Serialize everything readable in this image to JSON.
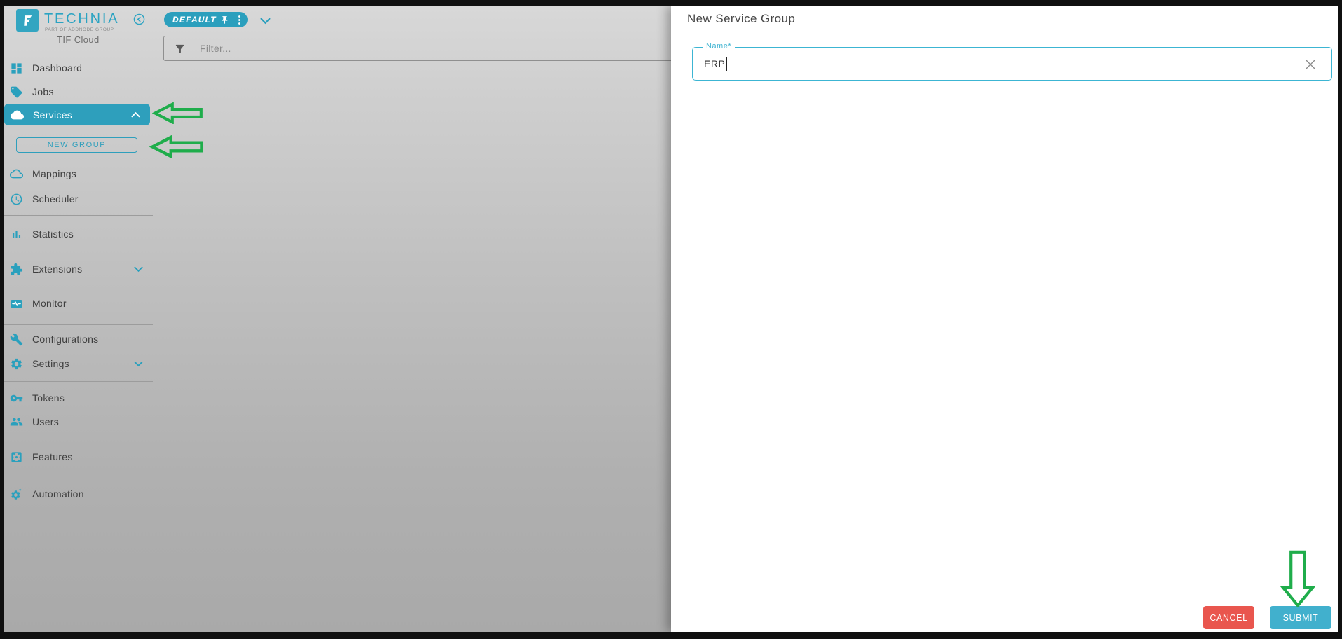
{
  "header": {
    "brand": "TECHNIA",
    "brand_tagline": "PART OF ADDNODE GROUP",
    "environment_badge": "DEFAULT",
    "app_name": "TIF Cloud",
    "filter_placeholder": "Filter..."
  },
  "sidebar": {
    "items": [
      {
        "label": "Dashboard",
        "icon": "dashboard-icon"
      },
      {
        "label": "Jobs",
        "icon": "jobs-tag-icon"
      },
      {
        "label": "Services",
        "icon": "services-cloud-icon",
        "selected": true,
        "expanded": true
      },
      {
        "label": "Mappings",
        "icon": "mappings-cloud-icon"
      },
      {
        "label": "Scheduler",
        "icon": "scheduler-clock-icon"
      },
      {
        "label": "Statistics",
        "icon": "statistics-bars-icon"
      },
      {
        "label": "Extensions",
        "icon": "extensions-puzzle-icon",
        "collapsible": true
      },
      {
        "label": "Monitor",
        "icon": "monitor-pulse-icon"
      },
      {
        "label": "Configurations",
        "icon": "configurations-wrench-icon"
      },
      {
        "label": "Settings",
        "icon": "settings-gear-icon",
        "collapsible": true
      },
      {
        "label": "Tokens",
        "icon": "tokens-key-icon"
      },
      {
        "label": "Users",
        "icon": "users-group-icon"
      },
      {
        "label": "Features",
        "icon": "features-gear-square-icon"
      },
      {
        "label": "Automation",
        "icon": "automation-gear-sparkle-icon"
      }
    ],
    "new_group_label": "NEW GROUP"
  },
  "dialog": {
    "title": "New Service Group",
    "name_label": "Name*",
    "name_value": "ERP",
    "cancel_label": "CANCEL",
    "submit_label": "SUBMIT"
  },
  "colors": {
    "accent_teal": "#2e9fbc",
    "field_border_teal": "#3cb5d3",
    "submit_teal": "#41b0cd",
    "cancel_red": "#e9564e",
    "annotation_green": "#1fad4b"
  }
}
